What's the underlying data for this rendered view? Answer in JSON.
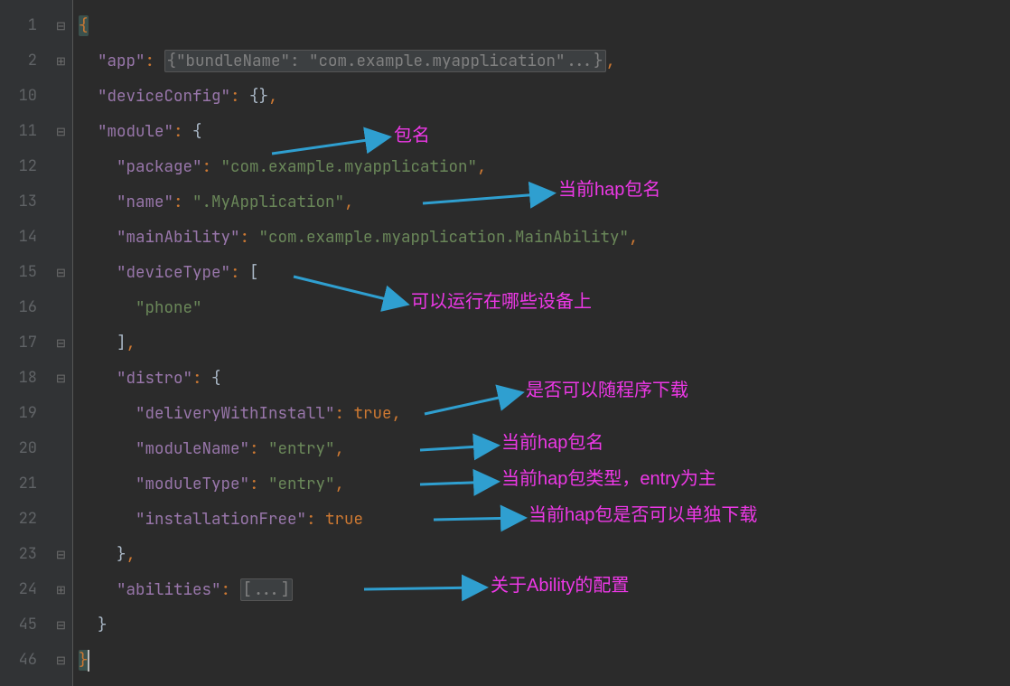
{
  "line_numbers": [
    "1",
    "2",
    "10",
    "11",
    "12",
    "13",
    "14",
    "15",
    "16",
    "17",
    "18",
    "19",
    "20",
    "21",
    "22",
    "23",
    "24",
    "45",
    "46"
  ],
  "fold_glyphs": [
    "⊟",
    "⊞",
    "",
    "⊟",
    "",
    "",
    "",
    "⊟",
    "",
    "⊟",
    "⊟",
    "",
    "",
    "",
    "",
    "⊟",
    "⊞",
    "⊟",
    "⊟"
  ],
  "code": {
    "l1_brace": "{",
    "l2_key": "\"app\"",
    "l2_folded": "{\"bundleName\": \"com.example.myapplication\"...}",
    "l10_key": "\"deviceConfig\"",
    "l10_val": "{}",
    "l11_key": "\"module\"",
    "l12_key": "\"package\"",
    "l12_val": "\"com.example.myapplication\"",
    "l13_key": "\"name\"",
    "l13_val": "\".MyApplication\"",
    "l14_key": "\"mainAbility\"",
    "l14_val": "\"com.example.myapplication.MainAbility\"",
    "l15_key": "\"deviceType\"",
    "l16_val": "\"phone\"",
    "l18_key": "\"distro\"",
    "l19_key": "\"deliveryWithInstall\"",
    "l19_val": "true",
    "l20_key": "\"moduleName\"",
    "l20_val": "\"entry\"",
    "l21_key": "\"moduleType\"",
    "l21_val": "\"entry\"",
    "l22_key": "\"installationFree\"",
    "l22_val": "true",
    "l24_key": "\"abilities\"",
    "l24_folded": "[...]",
    "l46_brace": "}"
  },
  "annotations": {
    "a_package": "包名",
    "a_name": "当前hap包名",
    "a_deviceType": "可以运行在哪些设备上",
    "a_delivery": "是否可以随程序下载",
    "a_moduleName": "当前hap包名",
    "a_moduleType": "当前hap包类型，entry为主",
    "a_installationFree": "当前hap包是否可以单独下载",
    "a_abilities": "关于Ability的配置"
  },
  "colors": {
    "arrow": "#2f9fd0"
  }
}
